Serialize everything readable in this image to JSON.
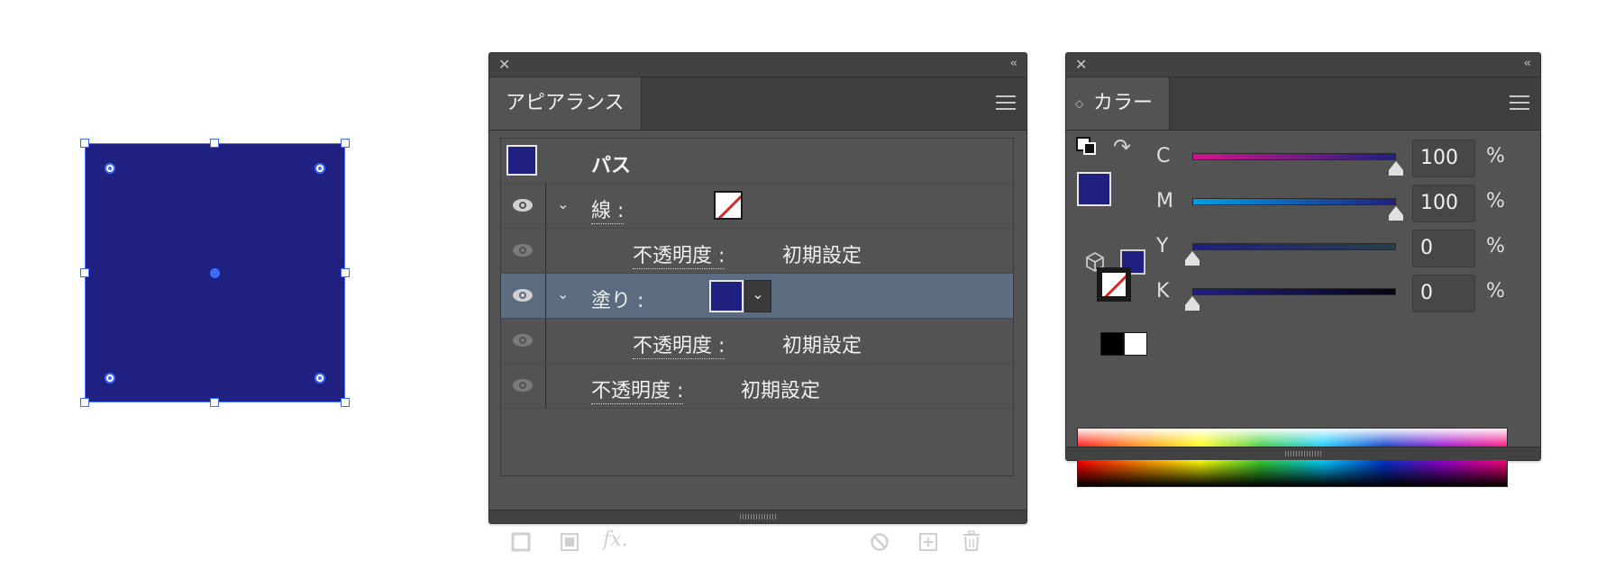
{
  "appearance_panel": {
    "title": "アピアランス",
    "close_glyph": "✕",
    "collapse_glyph": "‹‹",
    "header_label": "パス",
    "fill_color": "#1f2080",
    "rows": [
      {
        "label": "線 :",
        "kind": "stroke"
      },
      {
        "label": "不透明度 :",
        "value": "初期設定",
        "kind": "stroke-opacity"
      },
      {
        "label": "塗り :",
        "kind": "fill"
      },
      {
        "label": "不透明度 :",
        "value": "初期設定",
        "kind": "fill-opacity"
      },
      {
        "label": "不透明度 :",
        "value": "初期設定",
        "kind": "object-opacity"
      }
    ],
    "footer_icons": [
      "add-stroke-icon",
      "add-fill-icon",
      "fx-icon",
      "clear-appearance-icon",
      "duplicate-item-icon",
      "delete-icon"
    ],
    "fx_label": "fx."
  },
  "color_panel": {
    "title": "カラー",
    "close_glyph": "✕",
    "collapse_glyph": "‹‹",
    "channels": [
      {
        "name": "C",
        "value": "100",
        "unit": "%",
        "level": 1.0
      },
      {
        "name": "M",
        "value": "100",
        "unit": "%",
        "level": 1.0
      },
      {
        "name": "Y",
        "value": "0",
        "unit": "%",
        "level": 0.0
      },
      {
        "name": "K",
        "value": "0",
        "unit": "%",
        "level": 0.0
      }
    ],
    "fill_color": "#1f2080",
    "quick_swatches": [
      "none",
      "#000000",
      "#ffffff"
    ]
  },
  "canvas": {
    "shape_color": "#1f2080",
    "selection_color": "#3c6cff"
  }
}
